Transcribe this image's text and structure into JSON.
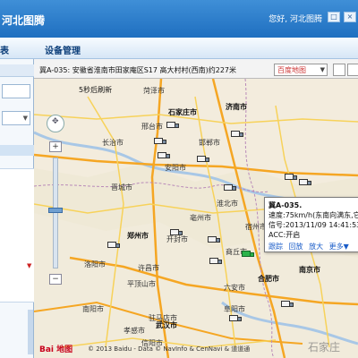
{
  "window": {
    "title": "河北图腾",
    "user_greeting": "您好, 河北图腾",
    "buttons": [
      "□",
      "×"
    ]
  },
  "menu": {
    "items": [
      "表",
      "设备管理"
    ]
  },
  "toolbar": {
    "vehicle_status": "冀A-035: 安徽省淮南市田家庵区S17 高大村村(西南)约227米",
    "map_type": "百度地图"
  },
  "map": {
    "refresh_label": "5秒后刷新",
    "cities": [
      "菏泽市",
      "石家庄市",
      "济南市",
      "邢台市",
      "长治市",
      "邯郸市",
      "晋城市",
      "安阳市",
      "郑州市",
      "洛阳市",
      "开封市",
      "商丘市",
      "许昌市",
      "平顶山市",
      "南阳市",
      "驻马店市",
      "信阳市",
      "阜阳市",
      "亳州市",
      "合肥市",
      "六安市",
      "南京市",
      "武汉市",
      "孝感市",
      "宿州市",
      "淮北市"
    ],
    "info_window": {
      "title": "冀A-035.",
      "speed": "速度:75km/h(东南向满东,它",
      "signal": "信号:2013/11/09 14:41:53",
      "acc": "ACC:开启",
      "actions": [
        "跟踪",
        "回放",
        "放大",
        "更多▼"
      ]
    },
    "baidu_logo": "Bai 地图",
    "copyright": "© 2013 Baidu - Data © NavInfo & CenNavi & 道道通",
    "watermark": "石家庄"
  }
}
